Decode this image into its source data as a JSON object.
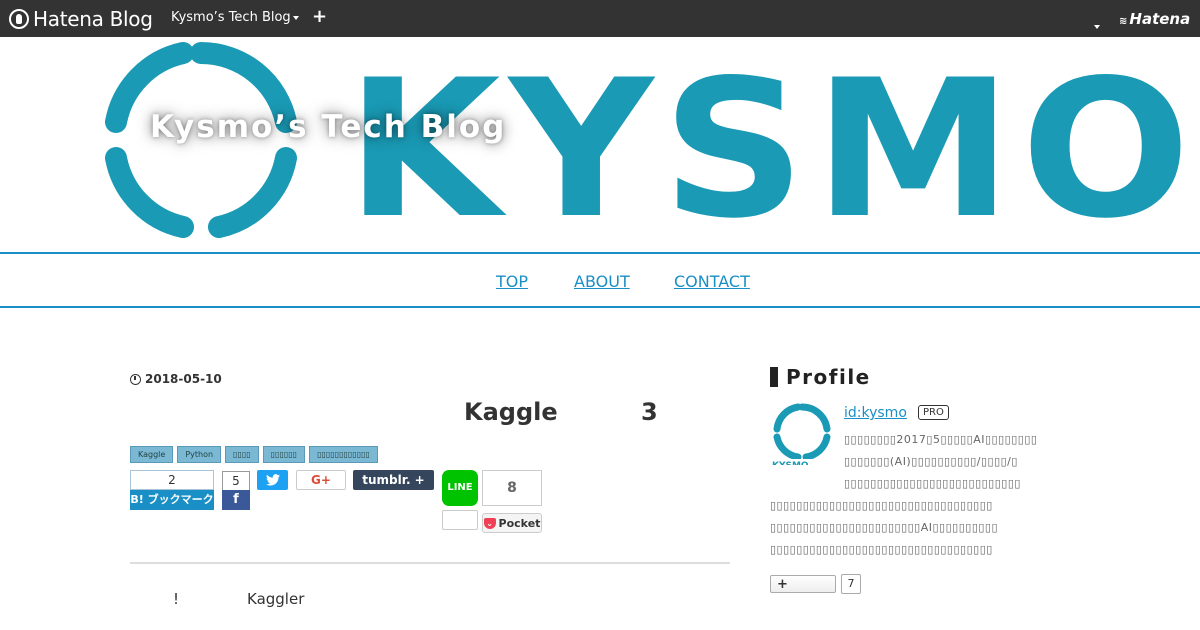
{
  "topbar": {
    "logo_text": "Hatena Blog",
    "blog_switch": "Kysmo’s Tech Blog",
    "plus": "+",
    "hatena_logo": "Hatena",
    "bg_color": "#333333"
  },
  "header": {
    "blog_title": "Kysmo’s Tech Blog",
    "banner_word": "KYSMO",
    "brand_color": "#1a9ab5"
  },
  "nav": {
    "items": [
      {
        "label": "TOP"
      },
      {
        "label": "ABOUT"
      },
      {
        "label": "CONTACT"
      }
    ],
    "color": "#1a8fc6"
  },
  "entry": {
    "date": "2018-05-10",
    "title": "Kaggle",
    "title_num": "3",
    "categories": [
      "Kaggle",
      "Python",
      "▯▯▯▯",
      "▯▯▯▯▯▯",
      "▯▯▯▯▯▯▯▯▯▯▯▯"
    ],
    "share": {
      "hatena_count": "2",
      "hatena_label": "B! ブックマーク",
      "facebook_count": "5",
      "facebook_label": "f",
      "twitter_label": "✔",
      "gplus_label": "G+",
      "tumblr_label": "tumblr.  +",
      "line_label": "LINE",
      "pocket_count": "8",
      "pocket_label": "Pocket"
    },
    "body_excl": "!",
    "body_kaggler": "Kaggler"
  },
  "sidebar": {
    "profile_heading": "Profile",
    "profile_id": "id:kysmo",
    "pro_badge": "PRO",
    "desc_lines": [
      "▯▯▯▯▯▯▯▯2017▯5▯▯▯▯▯AI▯▯▯▯▯▯▯▯",
      "▯▯▯▯▯▯▯(AI)▯▯▯▯▯▯▯▯▯▯/▯▯▯▯/▯",
      "▯▯▯▯▯▯▯▯▯▯▯▯▯▯▯▯▯▯▯▯▯▯▯▯▯▯▯",
      "▯▯▯▯▯▯▯▯▯▯▯▯▯▯▯▯▯▯▯▯▯▯▯▯▯▯▯▯▯▯▯▯▯▯",
      "▯▯▯▯▯▯▯▯▯▯▯▯▯▯▯▯▯▯▯▯▯▯▯AI▯▯▯▯▯▯▯▯▯▯",
      "▯▯▯▯▯▯▯▯▯▯▯▯▯▯▯▯▯▯▯▯▯▯▯▯▯▯▯▯▯▯▯▯▯▯"
    ],
    "follow_label": "+",
    "follow_count": "7"
  }
}
